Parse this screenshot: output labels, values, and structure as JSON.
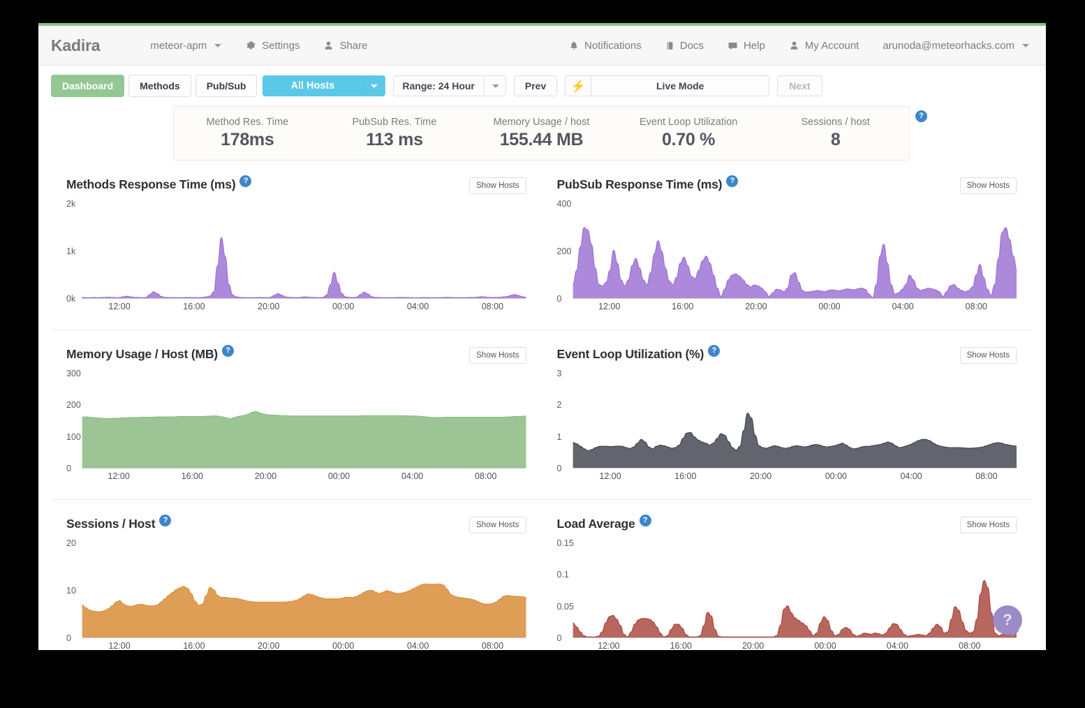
{
  "brand": "Kadira",
  "navbar": {
    "app_selector": "meteor-apm",
    "settings": "Settings",
    "share": "Share",
    "notifications": "Notifications",
    "docs": "Docs",
    "help": "Help",
    "my_account": "My Account",
    "account_email": "arunoda@meteorhacks.com"
  },
  "tabs": [
    {
      "label": "Dashboard",
      "active": true
    },
    {
      "label": "Methods",
      "active": false
    },
    {
      "label": "Pub/Sub",
      "active": false
    }
  ],
  "controls": {
    "hosts": "All Hosts",
    "range": "Range: 24 Hour",
    "prev": "Prev",
    "live_mode": "Live Mode",
    "next": "Next",
    "bolt_icon": "lightning-bolt-icon"
  },
  "summary": {
    "help_icon": "question-mark-icon",
    "cells": [
      {
        "label": "Method Res. Time",
        "value": "178ms"
      },
      {
        "label": "PubSub Res. Time",
        "value": "113 ms"
      },
      {
        "label": "Memory Usage / host",
        "value": "155.44 MB"
      },
      {
        "label": "Event Loop Utilization",
        "value": "0.70 %"
      },
      {
        "label": "Sessions / host",
        "value": "8"
      }
    ]
  },
  "show_hosts_label": "Show Hosts",
  "help_fab": "?",
  "colors": {
    "accent_green": "#95c795",
    "accent_blue": "#5bc8e8",
    "purple_series": "#9b6fd4",
    "green_series": "#8bba83",
    "dark_series": "#3f434e",
    "orange_series": "#d9913f",
    "red_series": "#a8453c",
    "help_badge": "#3d87c9",
    "bolt": "#fa6b61",
    "fab_purple": "#9b8cc8"
  },
  "chart_data": [
    {
      "id": "methods-response-time",
      "type": "area",
      "title": "Methods Response Time (ms)",
      "color": "#9b6fd4",
      "xlabel": "",
      "ylabel": "",
      "ylim": [
        0,
        2000
      ],
      "yticks": [
        0,
        1000,
        2000
      ],
      "ytick_labels": [
        "0k",
        "1k",
        "2k"
      ],
      "xticks": [
        "12:00",
        "16:00",
        "20:00",
        "00:00",
        "04:00",
        "08:00"
      ],
      "grid": false,
      "values": [
        30,
        25,
        22,
        28,
        24,
        26,
        30,
        35,
        30,
        25,
        28,
        45,
        55,
        40,
        30,
        28,
        26,
        30,
        90,
        150,
        110,
        50,
        30,
        28,
        26,
        25,
        24,
        26,
        30,
        28,
        26,
        25,
        30,
        40,
        60,
        150,
        700,
        1290,
        900,
        300,
        80,
        40,
        30,
        26,
        25,
        24,
        26,
        30,
        28,
        26,
        30,
        70,
        110,
        80,
        40,
        30,
        28,
        26,
        30,
        40,
        38,
        30,
        28,
        26,
        30,
        80,
        300,
        560,
        330,
        110,
        40,
        30,
        28,
        35,
        90,
        140,
        100,
        45,
        30,
        28,
        26,
        25,
        24,
        26,
        28,
        30,
        28,
        26,
        25,
        24,
        26,
        28,
        26,
        25,
        24,
        26,
        28,
        30,
        28,
        26,
        25,
        24,
        26,
        28,
        30,
        35,
        45,
        40,
        32,
        28,
        30,
        35,
        40,
        50,
        75,
        90,
        70,
        45,
        30
      ]
    },
    {
      "id": "pubsub-response-time",
      "type": "area",
      "title": "PubSub Response Time (ms)",
      "color": "#9b6fd4",
      "xlabel": "",
      "ylabel": "",
      "ylim": [
        0,
        400
      ],
      "yticks": [
        0,
        200,
        400
      ],
      "ytick_labels": [
        "0",
        "200",
        "400"
      ],
      "xticks": [
        "12:00",
        "16:00",
        "20:00",
        "00:00",
        "04:00",
        "08:00"
      ],
      "grid": false,
      "values": [
        60,
        120,
        220,
        300,
        290,
        230,
        130,
        60,
        55,
        70,
        120,
        205,
        150,
        80,
        55,
        80,
        140,
        170,
        130,
        80,
        60,
        110,
        190,
        245,
        200,
        130,
        75,
        60,
        90,
        150,
        175,
        140,
        95,
        85,
        120,
        160,
        180,
        150,
        100,
        45,
        10,
        40,
        80,
        100,
        105,
        95,
        80,
        60,
        50,
        58,
        55,
        45,
        30,
        10,
        25,
        40,
        38,
        30,
        45,
        100,
        110,
        70,
        35,
        28,
        30,
        32,
        35,
        33,
        30,
        35,
        38,
        36,
        34,
        38,
        42,
        40,
        38,
        42,
        45,
        40,
        20,
        5,
        60,
        180,
        230,
        150,
        60,
        20,
        25,
        40,
        60,
        100,
        80,
        45,
        35,
        40,
        45,
        42,
        38,
        30,
        10,
        30,
        55,
        60,
        45,
        35,
        30,
        35,
        50,
        100,
        145,
        90,
        40,
        15,
        60,
        170,
        280,
        300,
        250,
        180,
        120
      ]
    },
    {
      "id": "memory-usage-host",
      "type": "area",
      "title": "Memory Usage / Host (MB)",
      "color": "#8bba83",
      "xlabel": "",
      "ylabel": "",
      "ylim": [
        0,
        300
      ],
      "yticks": [
        0,
        100,
        200,
        300
      ],
      "ytick_labels": [
        "0",
        "100",
        "200",
        "300"
      ],
      "xticks": [
        "12:00",
        "16:00",
        "20:00",
        "00:00",
        "04:00",
        "08:00"
      ],
      "grid": false,
      "values": [
        162,
        163,
        162,
        161,
        160,
        159,
        158,
        158,
        158,
        159,
        159,
        160,
        160,
        161,
        161,
        161,
        162,
        162,
        162,
        162,
        163,
        163,
        163,
        163,
        163,
        163,
        164,
        164,
        164,
        164,
        164,
        164,
        164,
        165,
        165,
        166,
        166,
        165,
        163,
        160,
        157,
        160,
        164,
        166,
        168,
        172,
        178,
        180,
        176,
        172,
        170,
        169,
        168,
        168,
        167,
        167,
        166,
        166,
        166,
        166,
        166,
        166,
        166,
        166,
        166,
        166,
        166,
        166,
        166,
        166,
        166,
        166,
        166,
        166,
        166,
        166,
        167,
        167,
        167,
        167,
        167,
        167,
        167,
        167,
        167,
        167,
        167,
        167,
        166,
        166,
        166,
        165,
        164,
        163,
        162,
        161,
        161,
        161,
        162,
        162,
        162,
        162,
        162,
        162,
        162,
        162,
        162,
        162,
        162,
        162,
        162,
        162,
        162,
        162,
        162,
        163,
        163,
        164,
        164,
        165,
        166
      ]
    },
    {
      "id": "event-loop-utilization",
      "type": "area",
      "title": "Event Loop Utilization (%)",
      "color": "#3f434e",
      "xlabel": "",
      "ylabel": "",
      "ylim": [
        0,
        3
      ],
      "yticks": [
        0,
        1,
        2,
        3
      ],
      "ytick_labels": [
        "0",
        "1",
        "2",
        "3"
      ],
      "xticks": [
        "12:00",
        "16:00",
        "20:00",
        "00:00",
        "04:00",
        "08:00"
      ],
      "grid": false,
      "values": [
        0.82,
        0.78,
        0.7,
        0.62,
        0.56,
        0.6,
        0.66,
        0.7,
        0.7,
        0.7,
        0.69,
        0.7,
        0.71,
        0.7,
        0.66,
        0.63,
        0.68,
        0.8,
        0.92,
        0.84,
        0.68,
        0.62,
        0.7,
        0.74,
        0.72,
        0.68,
        0.64,
        0.66,
        0.74,
        0.95,
        1.12,
        1.14,
        1.0,
        0.9,
        0.84,
        0.8,
        0.74,
        0.8,
        0.95,
        1.1,
        1.05,
        0.85,
        0.66,
        0.58,
        0.7,
        1.2,
        1.75,
        1.6,
        1.05,
        0.72,
        0.66,
        0.64,
        0.68,
        0.72,
        0.7,
        0.66,
        0.64,
        0.66,
        0.7,
        0.72,
        0.7,
        0.68,
        0.7,
        0.74,
        0.76,
        0.74,
        0.7,
        0.68,
        0.7,
        0.72,
        0.76,
        0.8,
        0.74,
        0.66,
        0.62,
        0.64,
        0.68,
        0.7,
        0.7,
        0.72,
        0.74,
        0.76,
        0.8,
        0.84,
        0.8,
        0.72,
        0.66,
        0.68,
        0.72,
        0.76,
        0.82,
        0.88,
        0.92,
        0.92,
        0.88,
        0.8,
        0.74,
        0.7,
        0.68,
        0.66,
        0.66,
        0.66,
        0.66,
        0.65,
        0.64,
        0.64,
        0.65,
        0.66,
        0.68,
        0.72,
        0.76,
        0.8,
        0.82,
        0.8,
        0.76,
        0.74,
        0.72,
        0.7
      ]
    },
    {
      "id": "sessions-host",
      "type": "area",
      "title": "Sessions / Host",
      "color": "#d9913f",
      "xlabel": "",
      "ylabel": "",
      "ylim": [
        0,
        20
      ],
      "yticks": [
        0,
        10,
        20
      ],
      "ytick_labels": [
        "0",
        "10",
        "20"
      ],
      "xticks": [
        "12:00",
        "16:00",
        "20:00",
        "00:00",
        "04:00",
        "08:00"
      ],
      "grid": false,
      "values": [
        7.0,
        6.4,
        5.9,
        5.7,
        5.6,
        5.6,
        5.8,
        6.2,
        6.8,
        7.6,
        7.9,
        7.2,
        6.8,
        6.7,
        6.9,
        7.1,
        7.1,
        6.9,
        6.8,
        6.8,
        7.0,
        7.6,
        8.3,
        9.0,
        9.6,
        10.2,
        10.6,
        10.9,
        10.5,
        9.4,
        7.8,
        6.9,
        7.2,
        9.0,
        10.7,
        10.2,
        9.0,
        8.6,
        8.6,
        8.5,
        8.4,
        8.4,
        8.2,
        8.0,
        7.8,
        7.7,
        7.6,
        7.6,
        7.6,
        7.6,
        7.6,
        7.6,
        7.6,
        7.6,
        7.6,
        7.7,
        7.8,
        8.0,
        8.4,
        8.9,
        9.3,
        9.2,
        8.9,
        8.6,
        8.4,
        8.3,
        8.3,
        8.3,
        8.3,
        8.4,
        8.6,
        8.6,
        8.6,
        8.8,
        9.2,
        9.7,
        10.0,
        10.1,
        9.7,
        9.4,
        9.7,
        10.0,
        9.8,
        9.5,
        9.4,
        9.5,
        9.7,
        10.0,
        10.4,
        10.8,
        11.2,
        11.4,
        11.4,
        11.3,
        11.4,
        11.4,
        11.2,
        10.3,
        9.2,
        8.8,
        8.6,
        8.5,
        8.4,
        8.3,
        8.1,
        7.8,
        7.4,
        7.2,
        7.2,
        7.3,
        7.6,
        8.2,
        8.8,
        9.0,
        8.9,
        8.8,
        8.8,
        8.7,
        8.6
      ]
    },
    {
      "id": "load-average",
      "type": "area",
      "title": "Load Average",
      "color": "#a8453c",
      "xlabel": "",
      "ylabel": "",
      "ylim": [
        0,
        0.15
      ],
      "yticks": [
        0,
        0.05,
        0.1,
        0.15
      ],
      "ytick_labels": [
        "0",
        "0.05",
        "0.1",
        "0.15"
      ],
      "xticks": [
        "12:00",
        "16:00",
        "20:00",
        "00:00",
        "04:00",
        "08:00"
      ],
      "grid": false,
      "values": [
        0.024,
        0.018,
        0.01,
        0.004,
        0.002,
        0.002,
        0.002,
        0.003,
        0.01,
        0.024,
        0.034,
        0.036,
        0.03,
        0.02,
        0.006,
        0.002,
        0.01,
        0.022,
        0.029,
        0.031,
        0.031,
        0.03,
        0.026,
        0.018,
        0.008,
        0.002,
        0.004,
        0.014,
        0.022,
        0.022,
        0.016,
        0.006,
        0.002,
        0.002,
        0.002,
        0.004,
        0.02,
        0.041,
        0.035,
        0.014,
        0.003,
        0.002,
        0.002,
        0.002,
        0.002,
        0.002,
        0.002,
        0.002,
        0.002,
        0.002,
        0.002,
        0.002,
        0.002,
        0.002,
        0.002,
        0.002,
        0.004,
        0.02,
        0.046,
        0.051,
        0.04,
        0.032,
        0.028,
        0.024,
        0.02,
        0.012,
        0.004,
        0.008,
        0.024,
        0.034,
        0.028,
        0.012,
        0.004,
        0.006,
        0.014,
        0.017,
        0.014,
        0.006,
        0.003,
        0.005,
        0.008,
        0.007,
        0.006,
        0.008,
        0.007,
        0.005,
        0.008,
        0.016,
        0.023,
        0.022,
        0.014,
        0.006,
        0.003,
        0.004,
        0.005,
        0.006,
        0.005,
        0.004,
        0.008,
        0.016,
        0.022,
        0.018,
        0.008,
        0.01,
        0.03,
        0.05,
        0.044,
        0.026,
        0.012,
        0.008,
        0.01,
        0.03,
        0.07,
        0.091,
        0.08,
        0.04,
        0.008,
        0.004,
        0.006,
        0.008,
        0.01,
        0.012,
        0.014
      ]
    }
  ]
}
